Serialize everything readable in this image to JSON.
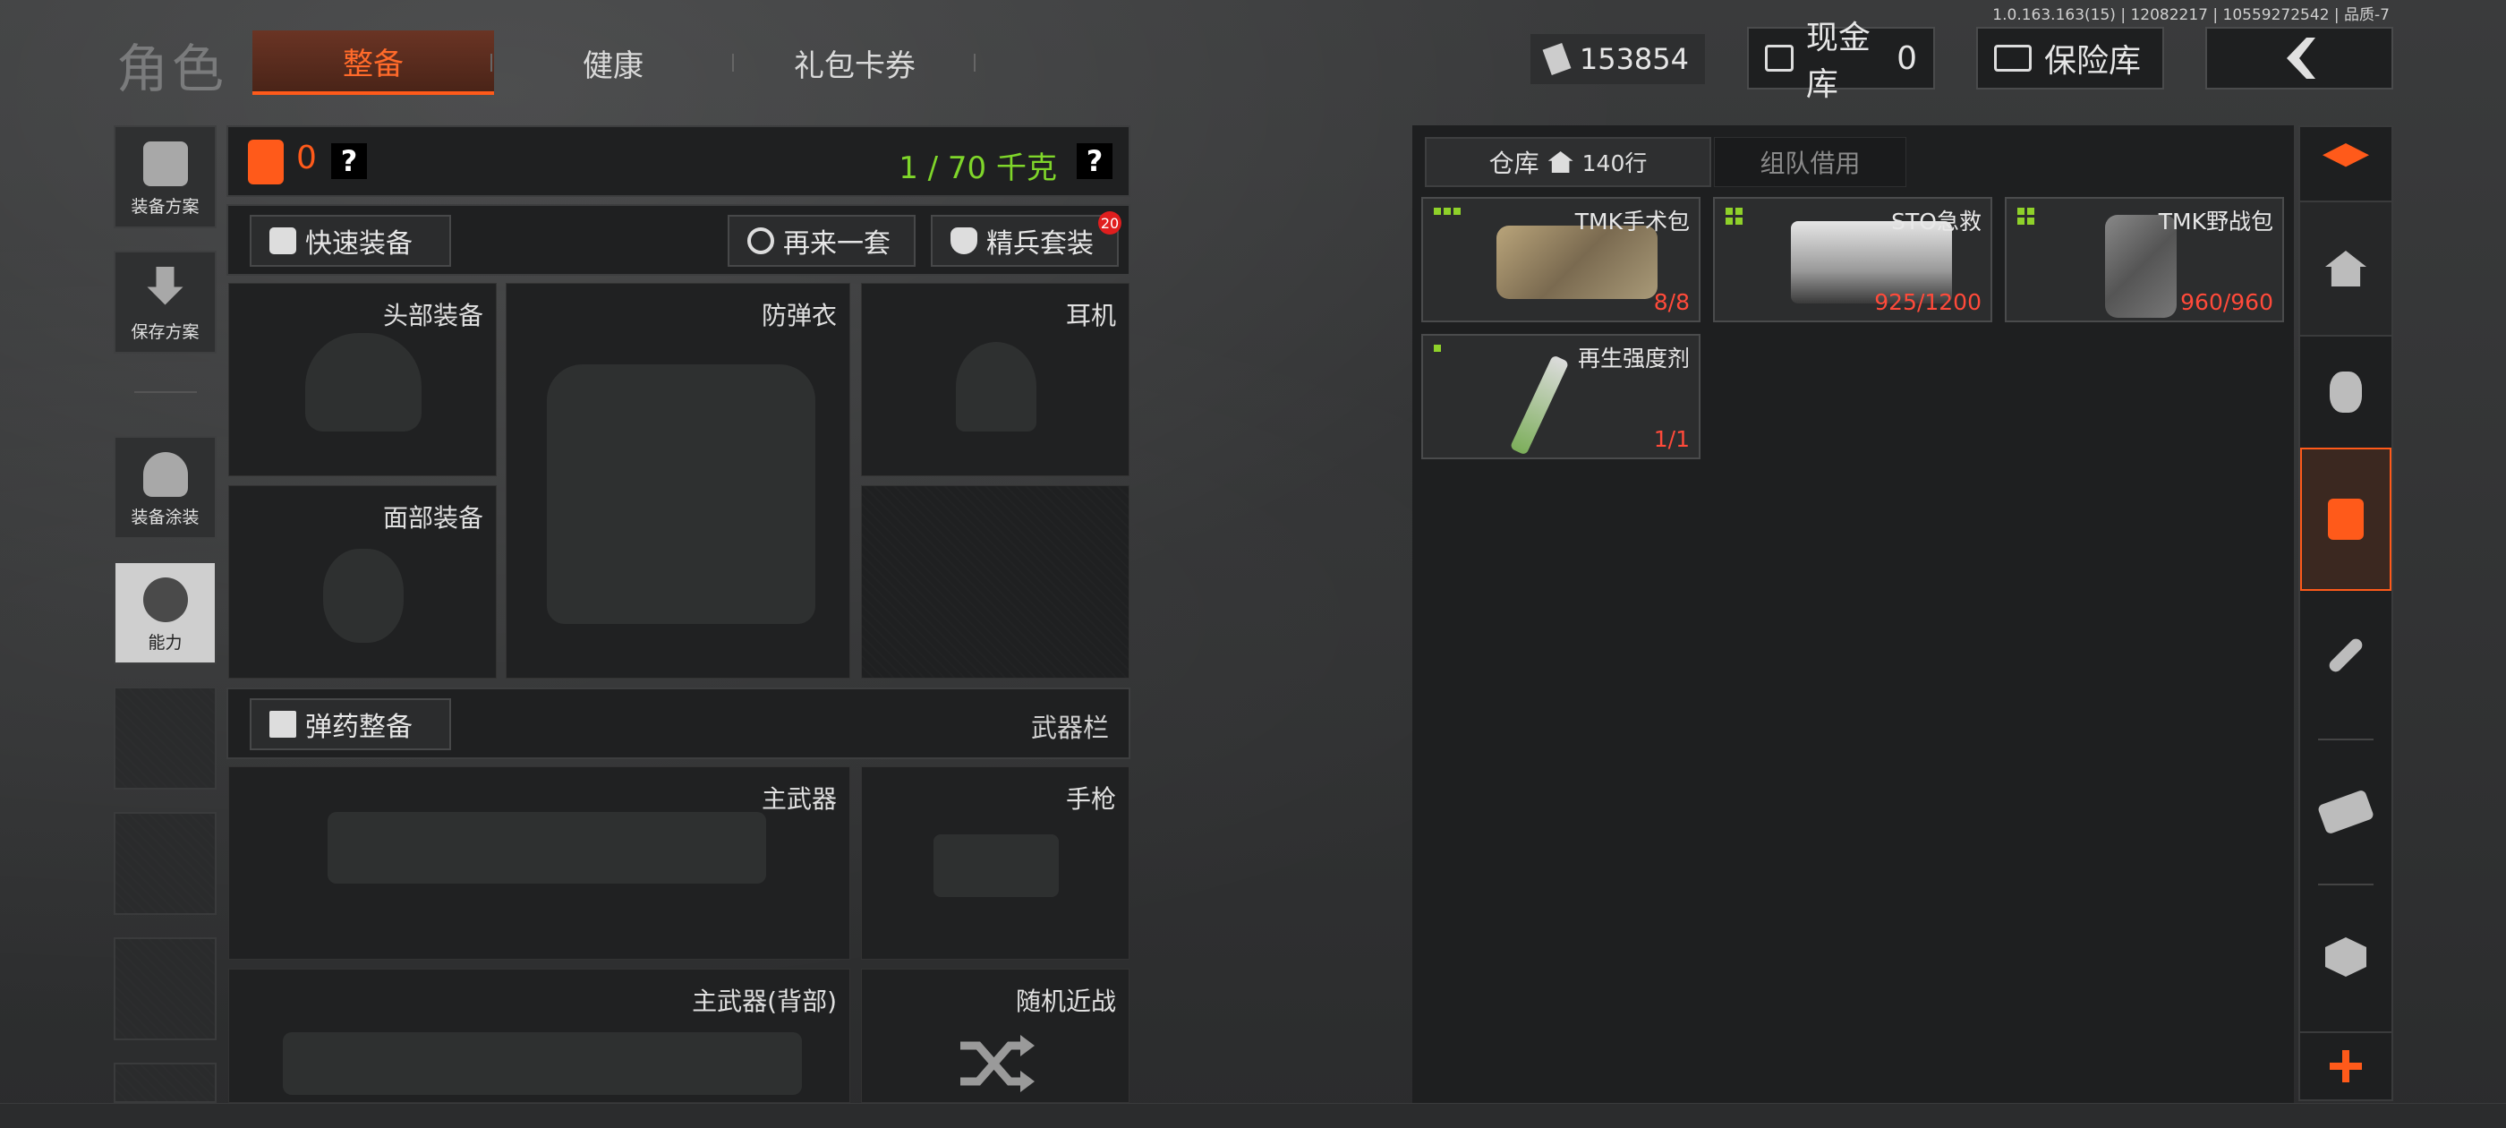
{
  "version_text": "1.0.163.163(15) | 12082217 | 10559272542 | 品质-7",
  "title": "角色",
  "tabs": [
    {
      "label": "整备",
      "active": true
    },
    {
      "label": "健康",
      "active": false
    },
    {
      "label": "礼包卡券",
      "active": false
    }
  ],
  "currency": {
    "cash_amount": "153854",
    "cash_vault_label": "现金库",
    "cash_vault_value": "0",
    "safe_label": "保险库"
  },
  "left_menu": [
    {
      "label": "装备方案",
      "icon": "armor-vest-icon"
    },
    {
      "label": "保存方案",
      "icon": "download-arrow-icon"
    },
    {
      "label": "装备涂装",
      "icon": "helmet-paint-icon"
    },
    {
      "label": "能力",
      "icon": "lightning-hexagon-icon"
    }
  ],
  "loadout": {
    "armor_count": "0",
    "help_glyph": "?",
    "weight": "1 / 70 千克",
    "quick_equip": "快速装备",
    "again_set": "再来一套",
    "elite_set": "精兵套装",
    "elite_badge": "20",
    "slots": {
      "head": "头部装备",
      "body_armor": "防弹衣",
      "headset": "耳机",
      "face": "面部装备",
      "primary": "主武器",
      "pistol": "手枪",
      "primary_back": "主武器(背部)",
      "random_melee": "随机近战"
    },
    "ammo_prep": "弹药整备",
    "weapon_bar": "武器栏"
  },
  "warehouse": {
    "tab_active": "仓库",
    "rows": "140行",
    "tab_team": "组队借用",
    "items": [
      {
        "name": "TMK手术包",
        "count": "8/8",
        "dots": 3
      },
      {
        "name": "STO急救",
        "count": "925/1200",
        "dots": 4
      },
      {
        "name": "TMK野战包",
        "count": "960/960",
        "dots": 4
      },
      {
        "name": "再生强度剂",
        "count": "1/1",
        "dots": 1
      }
    ]
  },
  "colors": {
    "accent": "#ff5a1a",
    "weight_green": "#7fd62a",
    "count_red": "#ff4a3a"
  }
}
